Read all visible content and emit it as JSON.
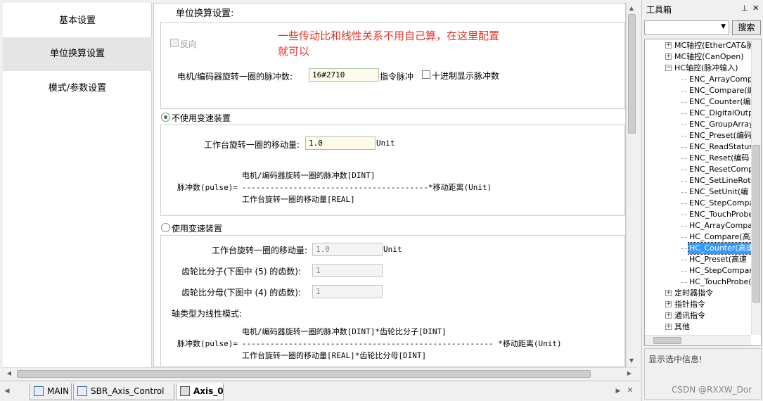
{
  "nav": {
    "items": [
      {
        "label": "基本设置"
      },
      {
        "label": "单位换算设置"
      },
      {
        "label": "模式/参数设置"
      }
    ]
  },
  "main": {
    "section_title": "单位换算设置:",
    "reverse_label": "反向",
    "annotation": [
      "一些传动比和线性关系不用自己算，在这里配置",
      "就可以"
    ],
    "pulses_per_rev_label": "电机/编码器旋转一圈的脉冲数:",
    "pulses_per_rev_value": "16#2710",
    "pulse_unit": "指令脉冲",
    "decimal_label": "十进制显示脉冲数",
    "no_gear": {
      "radio_label": "不使用变速装置",
      "travel_label": "工作台旋转一圈的移动量:",
      "travel_value": "1.0",
      "travel_unit": "Unit",
      "formula_lhs": "脉冲数(pulse)=",
      "formula_num": "电机/编码器旋转一圈的脉冲数[DINT]",
      "formula_line": "----------------------------------------*移动距离(Unit)",
      "formula_den": "工作台旋转一圈的移动量[REAL]"
    },
    "gear": {
      "radio_label": "使用变速装置",
      "travel_label": "工作台旋转一圈的移动量:",
      "travel_value": "1.0",
      "travel_unit": "Unit",
      "numerator_label": "齿轮比分子(下图中 (5) 的齿数):",
      "numerator_value": "1",
      "denominator_label": "齿轮比分母(下图中 (4) 的齿数):",
      "denominator_value": "1",
      "axis_type_label": "轴类型为线性模式:",
      "formula_lhs": "脉冲数(pulse)=",
      "formula_num": "电机/编码器旋转一圈的脉冲数[DINT]*齿轮比分子[DINT]",
      "formula_line": "------------------------------------------------------  *移动距离(Unit)",
      "formula_den": "工作台旋转一圈的移动量[REAL]*齿轮比分母[DINT]"
    }
  },
  "tabs": [
    {
      "label": "MAIN"
    },
    {
      "label": "SBR_Axis_Control"
    },
    {
      "label": "Axis_0"
    }
  ],
  "toolbox": {
    "title": "工具箱",
    "pin": "⊥",
    "close": "✕",
    "search_label": "搜索",
    "tree": [
      {
        "label": "MC轴控(EtherCAT&脉",
        "level": 0,
        "expander": "+"
      },
      {
        "label": "MC轴控(CanOpen)",
        "level": 0,
        "expander": "+"
      },
      {
        "label": "HC轴控(脉冲输入)",
        "level": 0,
        "expander": "−"
      },
      {
        "label": "ENC_ArrayCompa",
        "level": 1
      },
      {
        "label": "ENC_Compare(编",
        "level": 1
      },
      {
        "label": "ENC_Counter(编",
        "level": 1
      },
      {
        "label": "ENC_DigitalOutpu",
        "level": 1
      },
      {
        "label": "ENC_GroupArray",
        "level": 1
      },
      {
        "label": "ENC_Preset(编码",
        "level": 1
      },
      {
        "label": "ENC_ReadStatus(",
        "level": 1
      },
      {
        "label": "ENC_Reset(编码",
        "level": 1
      },
      {
        "label": "ENC_ResetCompa",
        "level": 1
      },
      {
        "label": "ENC_SetLineRota",
        "level": 1
      },
      {
        "label": "ENC_SetUnit(编",
        "level": 1
      },
      {
        "label": "ENC_StepCompar",
        "level": 1
      },
      {
        "label": "ENC_TouchProbe",
        "level": 1
      },
      {
        "label": "HC_ArrayCompar",
        "level": 1
      },
      {
        "label": "HC_Compare(高速",
        "level": 1
      },
      {
        "label": "HC_Counter(高速",
        "level": 1,
        "selected": true
      },
      {
        "label": "HC_Preset(高速",
        "level": 1
      },
      {
        "label": "HC_StepCompare",
        "level": 1
      },
      {
        "label": "HC_TouchProbe(",
        "level": 1
      },
      {
        "label": "定时器指令",
        "level": 0,
        "expander": "+"
      },
      {
        "label": "指针指令",
        "level": 0,
        "expander": "+"
      },
      {
        "label": "通讯指令",
        "level": 0,
        "expander": "+"
      },
      {
        "label": "其他",
        "level": 0,
        "expander": "+"
      }
    ],
    "info_label": "显示选中信息!",
    "watermark": "CSDN @RXXW_Dor"
  },
  "colors": {
    "annotation": "#e8342a",
    "selection": "#3399ff",
    "field_bg": "#fffbea"
  }
}
